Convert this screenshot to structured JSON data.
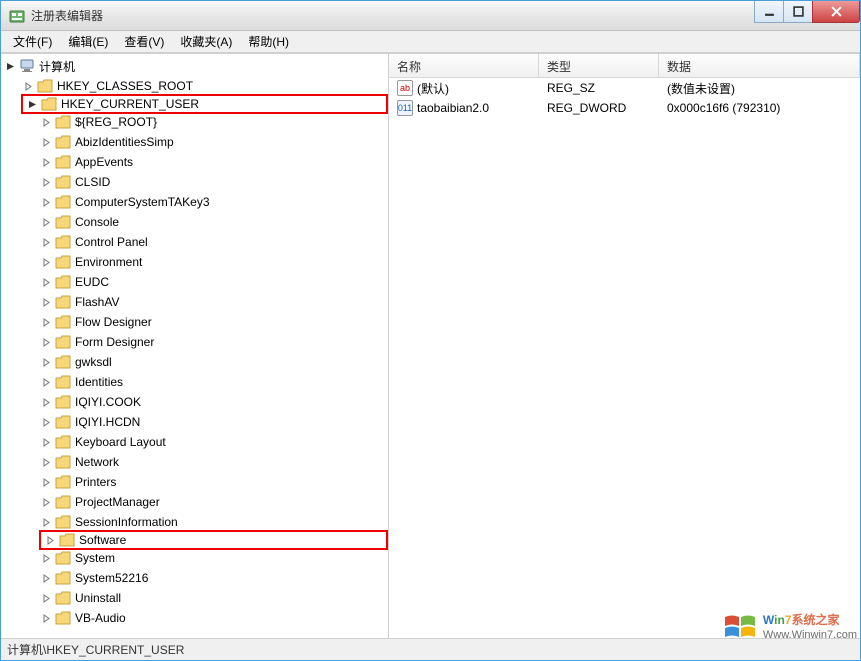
{
  "window": {
    "title": "注册表编辑器"
  },
  "menu": {
    "file": "文件(F)",
    "edit": "编辑(E)",
    "view": "查看(V)",
    "favorites": "收藏夹(A)",
    "help": "帮助(H)"
  },
  "tree": {
    "root": "计算机",
    "hkcr": "HKEY_CLASSES_ROOT",
    "hkcu": "HKEY_CURRENT_USER",
    "children": [
      "${REG_ROOT}",
      "AbizIdentitiesSimp",
      "AppEvents",
      "CLSID",
      "ComputerSystemTAKey3",
      "Console",
      "Control Panel",
      "Environment",
      "EUDC",
      "FlashAV",
      "Flow Designer",
      "Form Designer",
      "gwksdl",
      "Identities",
      "IQIYI.COOK",
      "IQIYI.HCDN",
      "Keyboard Layout",
      "Network",
      "Printers",
      "ProjectManager",
      "SessionInformation",
      "Software",
      "System",
      "System52216",
      "Uninstall",
      "VB-Audio"
    ]
  },
  "list": {
    "headers": {
      "name": "名称",
      "type": "类型",
      "data": "数据"
    },
    "rows": [
      {
        "icon": "sz",
        "name": "(默认)",
        "type": "REG_SZ",
        "data": "(数值未设置)"
      },
      {
        "icon": "dw",
        "name": "taobaibian2.0",
        "type": "REG_DWORD",
        "data": "0x000c16f6 (792310)"
      }
    ]
  },
  "status": {
    "path": "计算机\\HKEY_CURRENT_USER"
  },
  "watermark": {
    "brand_prefix": "W",
    "brand_in": "in",
    "brand_num": "7",
    "brand_suffix": "系统之家",
    "url": "Www.Winwin7.com"
  }
}
